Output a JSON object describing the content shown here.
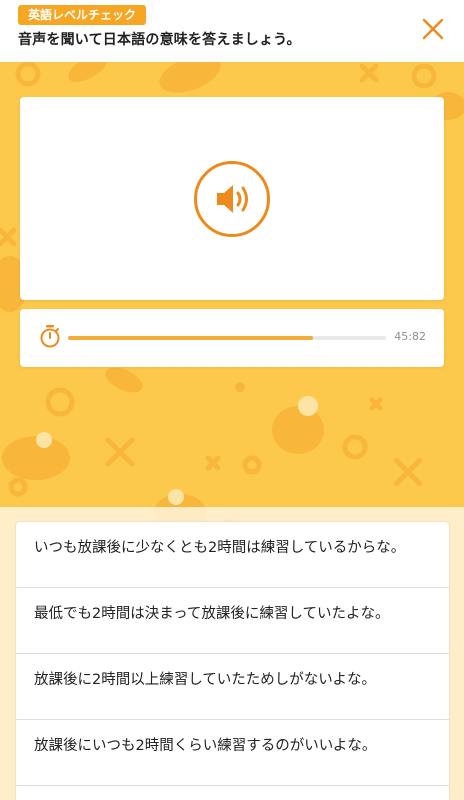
{
  "header": {
    "badge": "英語レベルチェック",
    "instruction": "音声を聞いて日本語の意味を答えましょう。"
  },
  "icons": {
    "close": "close-icon",
    "speaker": "speaker-icon",
    "timer": "stopwatch-icon"
  },
  "colors": {
    "accent": "#ee8a1d",
    "background": "#fcc94d",
    "badge": "#f6a623",
    "progress": "#f5ad3a"
  },
  "timer": {
    "display": "45:82",
    "progress_fraction": 0.77
  },
  "answers": [
    "いつも放課後に少なくとも2時間は練習しているからな。",
    "最低でも2時間は決まって放課後に練習していたよな。",
    "放課後に2時間以上練習していたためしがないよな。",
    "放課後にいつも2時間くらい練習するのがいいよな。"
  ]
}
